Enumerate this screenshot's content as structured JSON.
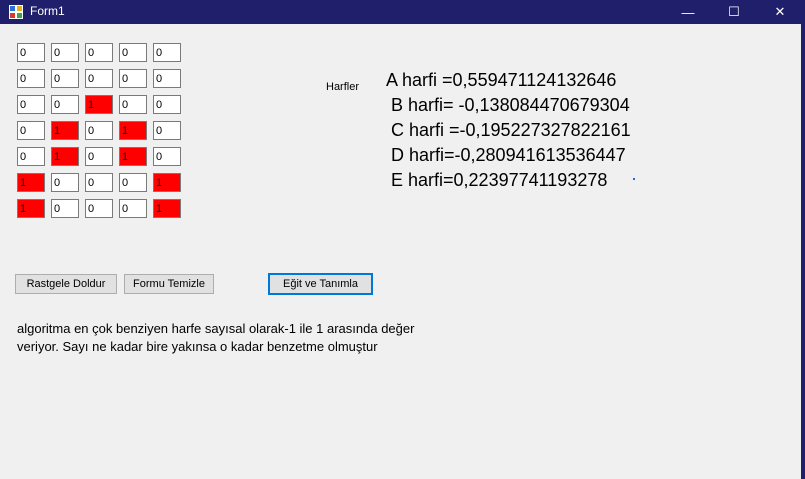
{
  "window": {
    "title": "Form1",
    "minimize_glyph": "—",
    "maximize_glyph": "☐",
    "close_glyph": "✕",
    "icon": "app-form-icon"
  },
  "grid": [
    [
      "0",
      "0",
      "0",
      "0",
      "0"
    ],
    [
      "0",
      "0",
      "0",
      "0",
      "0"
    ],
    [
      "0",
      "0",
      "1",
      "0",
      "0"
    ],
    [
      "0",
      "1",
      "0",
      "1",
      "0"
    ],
    [
      "0",
      "1",
      "0",
      "1",
      "0"
    ],
    [
      "1",
      "0",
      "0",
      "0",
      "1"
    ],
    [
      "1",
      "0",
      "0",
      "0",
      "1"
    ]
  ],
  "colors": {
    "active_cell": "#ff0000",
    "titlebar": "#1f1f6b",
    "focus_border": "#0078d7"
  },
  "harfler_label": "Harfler",
  "results": [
    "A harfi =0,559471124132646",
    "B harfi= -0,138084470679304",
    "C harfi =-0,195227327822161",
    "D harfi=-0,280941613536447",
    "E harfi=0,22397741193278"
  ],
  "buttons": {
    "fill": "Rastgele Doldur",
    "clear": "Formu Temizle",
    "train": "Eğit ve Tanımla"
  },
  "description": {
    "line1": "algoritma en çok benziyen harfe sayısal olarak-1 ile 1 arasında değer",
    "line2": "veriyor. Sayı ne kadar bire yakınsa o kadar benzetme olmuştur"
  }
}
